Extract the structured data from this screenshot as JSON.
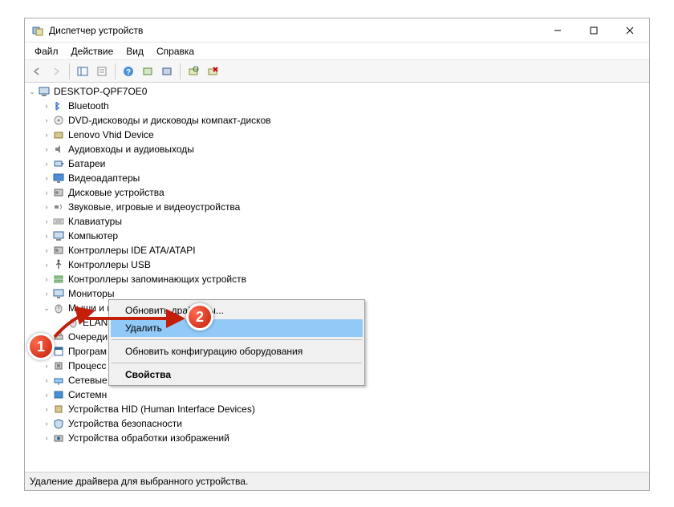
{
  "window": {
    "title": "Диспетчер устройств"
  },
  "menu": {
    "file": "Файл",
    "action": "Действие",
    "view": "Вид",
    "help": "Справка"
  },
  "tree": {
    "root": "DESKTOP-QPF7OE0",
    "items": [
      "Bluetooth",
      "DVD-дисководы и дисководы компакт-дисков",
      "Lenovo Vhid Device",
      "Аудиовходы и аудиовыходы",
      "Батареи",
      "Видеоадаптеры",
      "Дисковые устройства",
      "Звуковые, игровые и видеоустройства",
      "Клавиатуры",
      "Компьютер",
      "Контроллеры IDE ATA/ATAPI",
      "Контроллеры USB",
      "Контроллеры запоминающих устройств",
      "Мониторы"
    ],
    "expanded_label": "Мыши и иные указывающие устройства",
    "expanded_child": "ELAN",
    "tail": [
      "Очереди",
      "Програм",
      "Процесс",
      "Сетевые",
      "Системн",
      "Устройства HID (Human Interface Devices)",
      "Устройства безопасности",
      "Устройства обработки изображений"
    ]
  },
  "context_menu": {
    "update_drivers": "Обновить драйверы...",
    "delete": "Удалить",
    "scan_hw": "Обновить конфигурацию оборудования",
    "properties": "Свойства"
  },
  "statusbar": {
    "text": "Удаление драйвера для выбранного устройства."
  },
  "annotations": {
    "one": "1",
    "two": "2"
  }
}
